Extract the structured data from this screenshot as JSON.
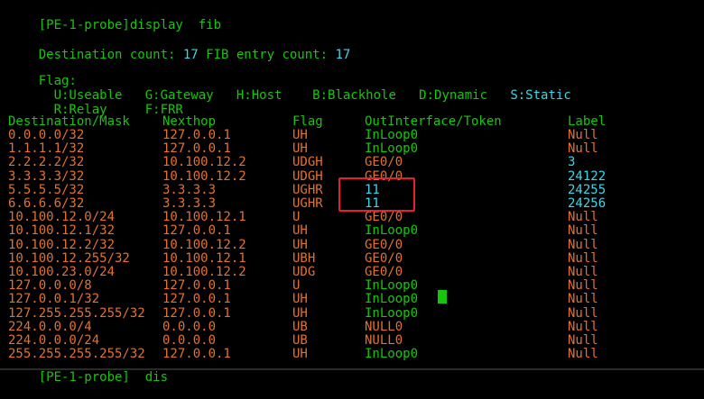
{
  "window": {
    "prompt_cmd": "[PE-1-probe]display  fib",
    "summary_label": "Destination count: ",
    "dest_count": "17",
    "fib_label": " FIB entry count: ",
    "fib_count": "17",
    "flag_title": "Flag:",
    "flags_row1_a": "  U:Useable   G:Gateway   H:Host    B:Blackhole   D:Dynamic   ",
    "flags_row1_b": "S:Static",
    "flags_row2": "  R:Relay     F:FRR",
    "bottom_prompt": "[PE-1-probe]  dis"
  },
  "table": {
    "headers": {
      "dest": "Destination/Mask",
      "nexthop": "Nexthop",
      "flag": "Flag",
      "iface": "OutInterface/Token",
      "label": "Label"
    },
    "rows": [
      {
        "dest": "0.0.0.0/32",
        "nexthop": "127.0.0.1",
        "flag": "UH",
        "iface": "InLoop0",
        "label": "Null"
      },
      {
        "dest": "1.1.1.1/32",
        "nexthop": "127.0.0.1",
        "flag": "UH",
        "iface": "InLoop0",
        "label": "Null"
      },
      {
        "dest": "2.2.2.2/32",
        "nexthop": "10.100.12.2",
        "flag": "UDGH",
        "iface": "GE0/0",
        "label": "3"
      },
      {
        "dest": "3.3.3.3/32",
        "nexthop": "10.100.12.2",
        "flag": "UDGH",
        "iface": "GE0/0",
        "label": "24122"
      },
      {
        "dest": "5.5.5.5/32",
        "nexthop": "3.3.3.3",
        "flag": "UGHR",
        "iface": "11",
        "label": "24255"
      },
      {
        "dest": "6.6.6.6/32",
        "nexthop": "3.3.3.3",
        "flag": "UGHR",
        "iface": "11",
        "label": "24256"
      },
      {
        "dest": "10.100.12.0/24",
        "nexthop": "10.100.12.1",
        "flag": "U",
        "iface": "GE0/0",
        "label": "Null"
      },
      {
        "dest": "10.100.12.1/32",
        "nexthop": "127.0.0.1",
        "flag": "UH",
        "iface": "InLoop0",
        "label": "Null"
      },
      {
        "dest": "10.100.12.2/32",
        "nexthop": "10.100.12.2",
        "flag": "UH",
        "iface": "GE0/0",
        "label": "Null"
      },
      {
        "dest": "10.100.12.255/32",
        "nexthop": "10.100.12.1",
        "flag": "UBH",
        "iface": "GE0/0",
        "label": "Null"
      },
      {
        "dest": "10.100.23.0/24",
        "nexthop": "10.100.12.2",
        "flag": "UDG",
        "iface": "GE0/0",
        "label": "Null"
      },
      {
        "dest": "127.0.0.0/8",
        "nexthop": "127.0.0.1",
        "flag": "U",
        "iface": "InLoop0",
        "label": "Null"
      },
      {
        "dest": "127.0.0.1/32",
        "nexthop": "127.0.0.1",
        "flag": "UH",
        "iface": "InLoop0",
        "label": "Null"
      },
      {
        "dest": "127.255.255.255/32",
        "nexthop": "127.0.0.1",
        "flag": "UH",
        "iface": "InLoop0",
        "label": "Null"
      },
      {
        "dest": "224.0.0.0/4",
        "nexthop": "0.0.0.0",
        "flag": "UB",
        "iface": "NULL0",
        "label": "Null"
      },
      {
        "dest": "224.0.0.0/24",
        "nexthop": "0.0.0.0",
        "flag": "UB",
        "iface": "NULL0",
        "label": "Null"
      },
      {
        "dest": "255.255.255.255/32",
        "nexthop": "127.0.0.1",
        "flag": "UH",
        "iface": "InLoop0",
        "label": "Null"
      }
    ]
  },
  "colors": {
    "background": "#000000",
    "green": "#16c60c",
    "orange": "#e1722f",
    "cyan": "#3ad7e8",
    "highlight_box": "#e8202a"
  }
}
